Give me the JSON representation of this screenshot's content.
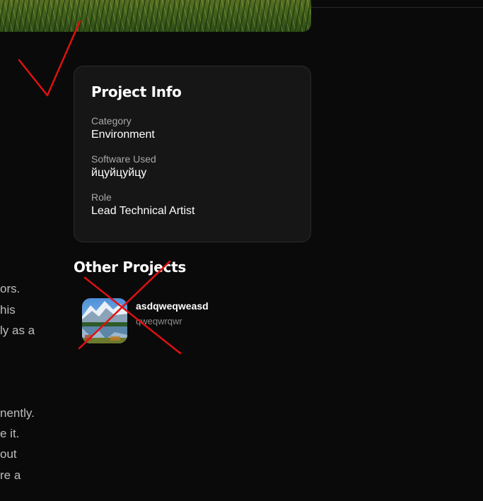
{
  "article": {
    "lines": [
      {
        "text": "ors."
      },
      {
        "text": "his"
      },
      {
        "text": "ly as a"
      },
      {
        "text": "nently."
      },
      {
        "text": "e it."
      },
      {
        "text": "out"
      },
      {
        "text": "re a"
      }
    ]
  },
  "project_info": {
    "title": "Project Info",
    "fields": [
      {
        "label": "Category",
        "value": "Environment"
      },
      {
        "label": "Software Used",
        "value": "йцуйцуйцу"
      },
      {
        "label": "Role",
        "value": "Lead Technical Artist"
      }
    ]
  },
  "other_projects": {
    "title": "Other Projects",
    "items": [
      {
        "name": "asdqweqweasd",
        "subtitle": "qweqwrqwr",
        "thumbnail_icon": "mountain-lake-image"
      }
    ]
  },
  "annotations": {
    "check_color": "#e01010",
    "cross_color": "#e01010"
  }
}
